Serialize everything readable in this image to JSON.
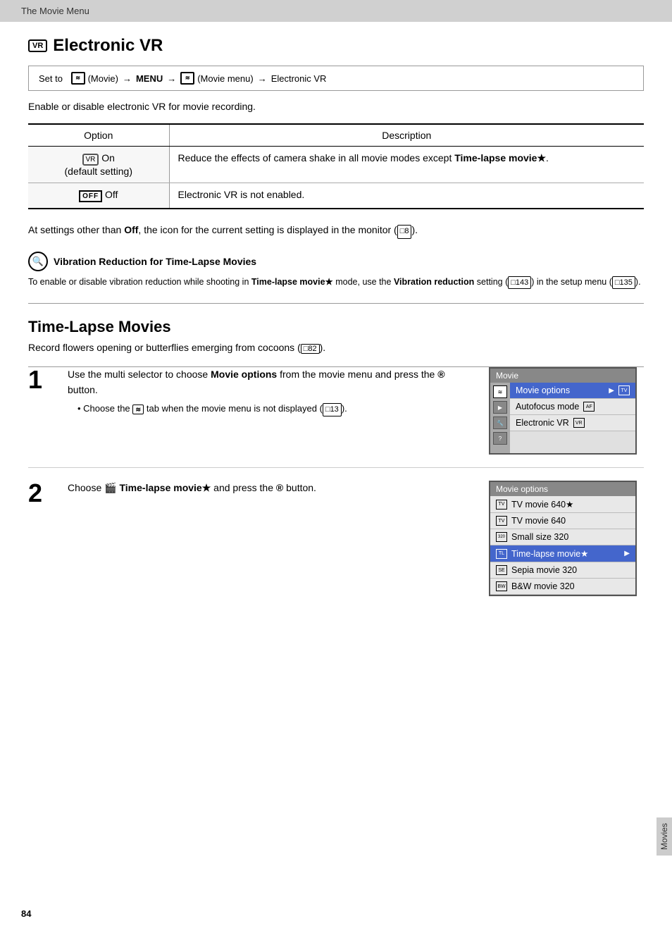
{
  "header": {
    "text": "The Movie Menu"
  },
  "evr_section": {
    "title": "Electronic VR",
    "icon_label": "VR",
    "nav": {
      "set_to": "Set to",
      "movie_icon": "≋",
      "movie_label": "(Movie)",
      "arrow1": "→",
      "menu_label": "MENU",
      "arrow2": "→",
      "movie_menu_label": "(Movie menu)",
      "arrow3": "→",
      "destination": "Electronic VR"
    },
    "description": "Enable or disable electronic VR for movie recording.",
    "table": {
      "col1": "Option",
      "col2": "Description",
      "rows": [
        {
          "option": "On\n(default setting)",
          "description": "Reduce the effects of camera shake in all movie modes except Time-lapse movie★."
        },
        {
          "option": "Off",
          "description": "Electronic VR is not enabled."
        }
      ]
    },
    "note": "At settings other than Off, the icon for the current setting is displayed in the monitor (□8).",
    "vr_note": {
      "title": "Vibration Reduction for Time-Lapse Movies",
      "body": "To enable or disable vibration reduction while shooting in Time-lapse movie★ mode, use the Vibration reduction setting (□143) in the setup menu (□135)."
    }
  },
  "timelapse_section": {
    "title": "Time-Lapse Movies",
    "description": "Record flowers opening or butterflies emerging from cocoons (□82).",
    "steps": [
      {
        "number": "1",
        "text": "Use the multi selector to choose Movie options from the movie menu and press the ® button.",
        "sub": "Choose the ≋ tab when the movie menu is not displayed (□13).",
        "menu_title": "Movie",
        "menu_items": [
          {
            "label": "Movie options",
            "icon": "TV",
            "selected": true,
            "has_arrow": true
          },
          {
            "label": "Autofocus mode",
            "icon": "AF",
            "selected": false,
            "has_arrow": false
          },
          {
            "label": "Electronic VR",
            "icon": "VR",
            "selected": false,
            "has_arrow": false
          }
        ]
      },
      {
        "number": "2",
        "text": "Choose 🎬 Time-lapse movie★ and press the ® button.",
        "sub": "",
        "menu_title": "Movie options",
        "menu_items": [
          {
            "label": "TV movie 640★",
            "icon": "TV",
            "selected": false,
            "has_arrow": false
          },
          {
            "label": "TV movie 640",
            "icon": "TV",
            "selected": false,
            "has_arrow": false
          },
          {
            "label": "Small size 320",
            "icon": "320",
            "selected": false,
            "has_arrow": false
          },
          {
            "label": "Time-lapse movie★",
            "icon": "TL",
            "selected": true,
            "has_arrow": true
          },
          {
            "label": "Sepia movie 320",
            "icon": "SE",
            "selected": false,
            "has_arrow": false
          },
          {
            "label": "B&W movie 320",
            "icon": "BW",
            "selected": false,
            "has_arrow": false
          }
        ]
      }
    ]
  },
  "footer": {
    "page_number": "84",
    "sidebar_label": "Movies"
  }
}
